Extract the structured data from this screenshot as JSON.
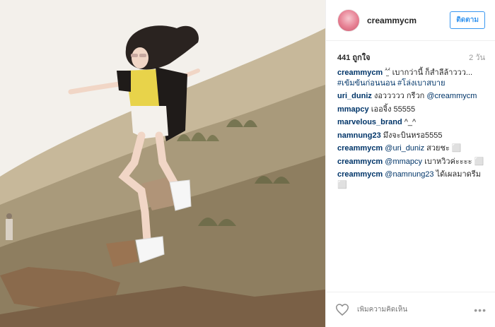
{
  "post": {
    "username": "creammycm",
    "follow_label": "ติดตาม",
    "likes": "441 ถูกใจ",
    "time": "2 วัน"
  },
  "comments": [
    {
      "user": "creammycm",
      "text": "ˆ̫̀ˆ́ เบากว่านี้ ก็สำลีล้าววว...",
      "tag": "#เข้มข้นก่อนนอน #โล่งเบาสบาย"
    },
    {
      "user": "uri_duniz",
      "text": "งอววววว กรีวก ",
      "mention": "@creammycm"
    },
    {
      "user": "mmapcy",
      "text": "เออจิ้ง 55555"
    },
    {
      "user": "marvelous_brand",
      "text": "^_^"
    },
    {
      "user": "namnung23",
      "text": "มึงจะบินหรอ5555"
    },
    {
      "user": "creammycm",
      "mention": "@uri_duniz",
      "text": " สวยชะ ⬜"
    },
    {
      "user": "creammycm",
      "mention": "@mmapcy",
      "text": " เบาหวิวค่ะะะะ ⬜"
    },
    {
      "user": "creammycm",
      "mention": "@namnung23",
      "text": " ได้เผลมาดรีม ⬜"
    }
  ],
  "footer": {
    "add_comment_placeholder": "เพิ่มความคิดเห็น",
    "more_label": "•••"
  },
  "icons": {
    "like": "heart-icon",
    "more": "more-options-icon"
  }
}
